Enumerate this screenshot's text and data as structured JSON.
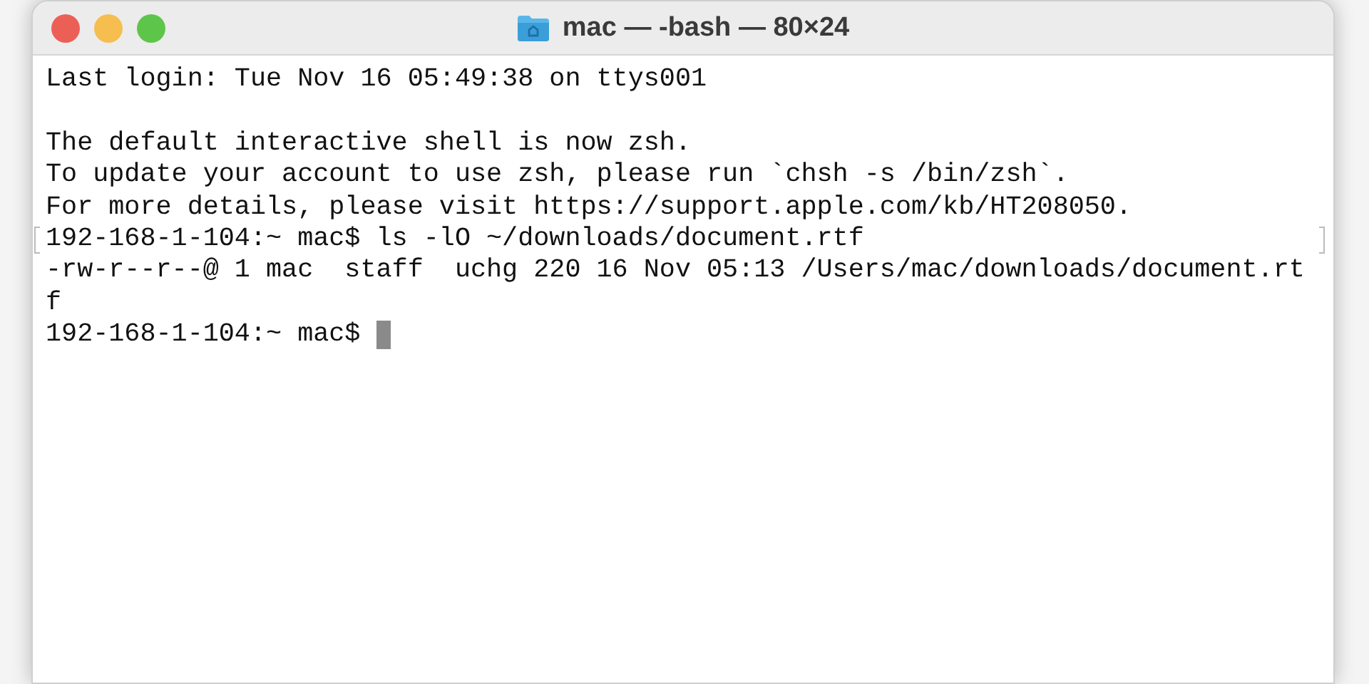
{
  "window": {
    "title": "mac — -bash — 80×24",
    "buttons": [
      {
        "color": "#ec5f57"
      },
      {
        "color": "#f5be4f"
      },
      {
        "color": "#5ec54b"
      }
    ]
  },
  "terminal": {
    "lines": [
      {
        "kind": "text",
        "text": "Last login: Tue Nov 16 05:49:38 on ttys001",
        "marked": false,
        "cursor": false
      },
      {
        "kind": "blank"
      },
      {
        "kind": "text",
        "text": "The default interactive shell is now zsh.",
        "marked": false,
        "cursor": false
      },
      {
        "kind": "text",
        "text": "To update your account to use zsh, please run `chsh -s /bin/zsh`.",
        "marked": false,
        "cursor": false
      },
      {
        "kind": "text",
        "text": "For more details, please visit https://support.apple.com/kb/HT208050.",
        "marked": false,
        "cursor": false
      },
      {
        "kind": "text",
        "text": "192-168-1-104:~ mac$ ls -lO ~/downloads/document.rtf",
        "marked": true,
        "cursor": false
      },
      {
        "kind": "text",
        "text": "-rw-r--r--@ 1 mac  staff  uchg 220 16 Nov 05:13 /Users/mac/downloads/document.rt",
        "marked": false,
        "cursor": false
      },
      {
        "kind": "text",
        "text": "f",
        "marked": false,
        "cursor": false
      },
      {
        "kind": "text",
        "text": "192-168-1-104:~ mac$ ",
        "marked": false,
        "cursor": true
      }
    ]
  }
}
